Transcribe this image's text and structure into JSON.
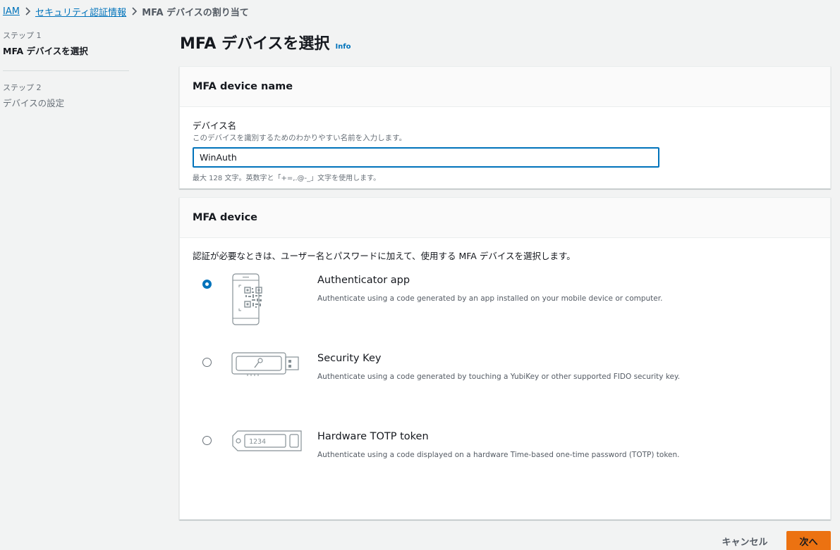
{
  "breadcrumb": {
    "items": [
      "IAM",
      "セキュリティ認証情報"
    ],
    "current": "MFA デバイスの割り当て"
  },
  "steps": [
    {
      "num": "ステップ 1",
      "title": "MFA デバイスを選択"
    },
    {
      "num": "ステップ 2",
      "title": "デバイスの設定"
    }
  ],
  "page": {
    "title": "MFA デバイスを選択",
    "info": "Info"
  },
  "device_name": {
    "header": "MFA device name",
    "label": "デバイス名",
    "description": "このデバイスを識別するためのわかりやすい名前を入力します。",
    "value": "WinAuth",
    "hint": "最大 128 文字。英数字と「+=,.@-_」文字を使用します。"
  },
  "mfa_device": {
    "header": "MFA device",
    "instruction": "認証が必要なときは、ユーザー名とパスワードに加えて、使用する MFA デバイスを選択します。",
    "options": [
      {
        "title": "Authenticator app",
        "desc": "Authenticate using a code generated by an app installed on your mobile device or computer.",
        "icon": "phone-qr-icon",
        "selected": true
      },
      {
        "title": "Security Key",
        "desc": "Authenticate using a code generated by touching a YubiKey or other supported FIDO security key.",
        "icon": "usb-key-icon",
        "selected": false
      },
      {
        "title": "Hardware TOTP token",
        "desc": "Authenticate using a code displayed on a hardware Time-based one-time password (TOTP) token.",
        "icon": "totp-token-icon",
        "selected": false,
        "token_digits": "1234"
      }
    ]
  },
  "footer": {
    "cancel": "キャンセル",
    "next": "次へ"
  },
  "colors": {
    "link": "#0073bb",
    "primary_button": "#ec7211",
    "background": "#f2f3f3"
  }
}
